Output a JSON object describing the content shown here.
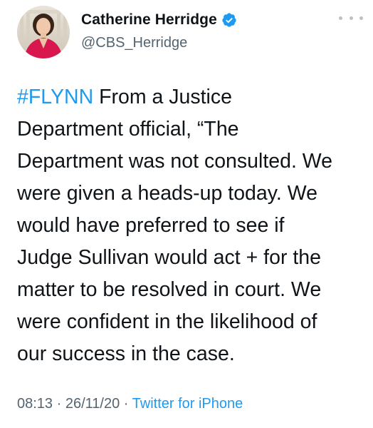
{
  "author": {
    "display_name": "Catherine Herridge",
    "handle": "@CBS_Herridge",
    "verified_icon": "verified-badge-icon"
  },
  "menu": {
    "icon": "more-options-icon"
  },
  "tweet": {
    "hashtag": "#FLYNN",
    "lines": [
      " From a Justice",
      "Department official, “The",
      "Department was not consulted. We",
      "were given a heads-up today. We",
      "would have preferred to see if",
      "Judge Sullivan would act + for the",
      "matter to be resolved in court. We",
      "were confident in the likelihood of",
      "our success in the case."
    ]
  },
  "meta": {
    "time": "08:13",
    "separator": " · ",
    "date": "26/11/20",
    "source": "Twitter for iPhone"
  },
  "colors": {
    "link": "#1d9bf0",
    "secondary_text": "#536471",
    "primary_text": "#0f1419"
  }
}
